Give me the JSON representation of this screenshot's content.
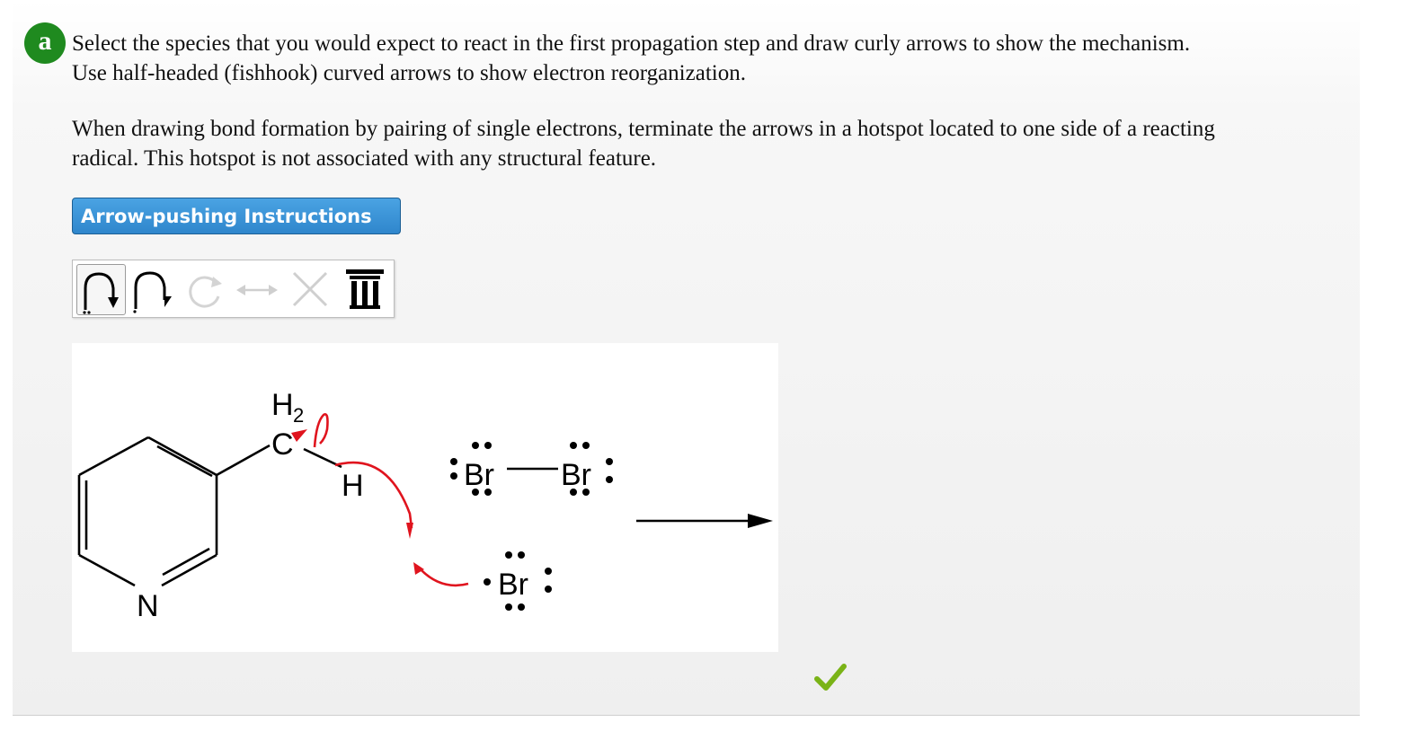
{
  "question": {
    "part_label": "a",
    "line1": "Select the species that you would expect to react in the first propagation step and draw curly arrows to show the mechanism.",
    "line2": "Use half-headed (fishhook) curved arrows to show electron reorganization.",
    "line3": "When drawing bond formation by pairing of single electrons, terminate the arrows in a hotspot located to one side of a reacting",
    "line4": "radical. This hotspot is not associated with any structural feature."
  },
  "help_button": {
    "label": "Arrow-pushing Instructions"
  },
  "toolbar": {
    "tools": [
      {
        "name": "full-arrow-tool",
        "selected": true
      },
      {
        "name": "fishhook-arrow-tool",
        "selected": false
      },
      {
        "name": "redo-tool",
        "disabled": true
      },
      {
        "name": "resonance-arrow-tool",
        "disabled": true
      },
      {
        "name": "clear-tool",
        "disabled": true
      },
      {
        "name": "delete-tool",
        "disabled": false
      }
    ]
  },
  "molecule": {
    "atom_N": "N",
    "atom_C": "C",
    "atom_H2": "H",
    "atom_H2_sub": "2",
    "atom_H": "H",
    "br2_left": "Br",
    "br2_right": "Br",
    "br_radical": "Br"
  },
  "colors": {
    "badge": "#1f8a1f",
    "button": "#2f86cc",
    "arrow": "#e0141e",
    "check": "#7ab317"
  },
  "status": {
    "icon": "checkmark-icon"
  }
}
